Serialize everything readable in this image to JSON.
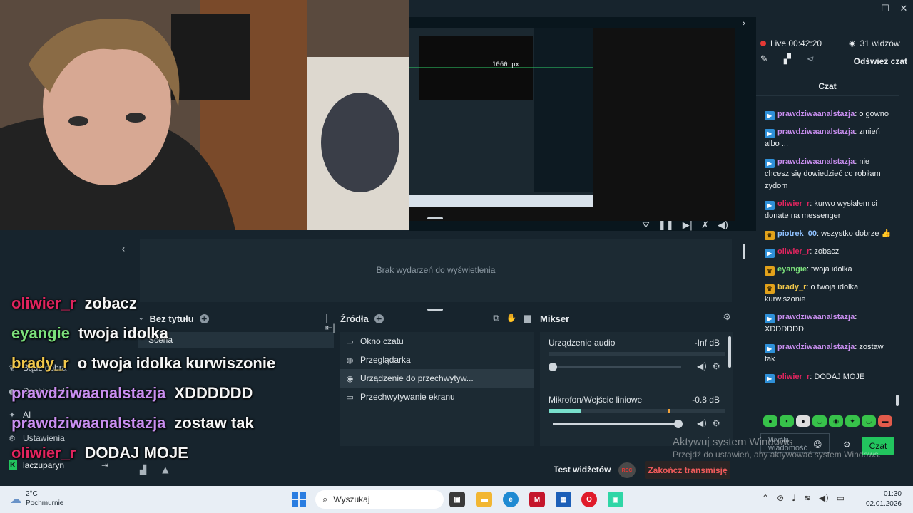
{
  "window": {
    "minimize": "—",
    "maximize": "☐",
    "close": "✕"
  },
  "preview": {
    "label_px": "1060 px",
    "collapse_icon": "chevron-right-icon",
    "tools": [
      "filter-icon",
      "pause-icon",
      "skip-icon",
      "mic-off-icon",
      "volume-icon"
    ]
  },
  "events": {
    "empty": "Brak wydarzeń do wyświetlenia"
  },
  "nav": {
    "items": [
      {
        "label": "Bądź dobra",
        "icon": "leaf-icon"
      },
      {
        "label": "Dashboard",
        "icon": "bell-icon"
      },
      {
        "label": "AI",
        "icon": "sparkle-icon"
      },
      {
        "label": "Ustawienia",
        "icon": "gear-icon"
      }
    ],
    "user": "laczuparyn",
    "user_badge": "K"
  },
  "scenes": {
    "title": "Bez tytułu",
    "items": [
      "Scena"
    ]
  },
  "sources": {
    "title": "Źródła",
    "items": [
      {
        "label": "Okno czatu",
        "icon": "chat-window-icon",
        "selected": false
      },
      {
        "label": "Przeglądarka",
        "icon": "globe-icon",
        "selected": false
      },
      {
        "label": "Urządzenie do przechwytyw...",
        "icon": "webcam-icon",
        "selected": true
      },
      {
        "label": "Przechwytywanie ekranu",
        "icon": "monitor-icon",
        "selected": false
      }
    ]
  },
  "mixer": {
    "title": "Mikser",
    "channels": [
      {
        "name": "Urządzenie audio",
        "db": "-Inf dB",
        "level": 0.0,
        "volume": 0.0
      },
      {
        "name": "Mikrofon/Wejście liniowe",
        "db": "-0.8 dB",
        "level": 0.18,
        "volume": 0.98
      }
    ]
  },
  "bottom": {
    "test_widgets": "Test widżetów",
    "rec": "REC",
    "end_stream": "Zakończ transmisję"
  },
  "overlay": [
    {
      "user": "oliwier_r",
      "color": "#e0245e",
      "msg": "zobacz"
    },
    {
      "user": "eyangie",
      "color": "#7be07b",
      "msg": "twoja idolka"
    },
    {
      "user": "brady_r",
      "color": "#f2c84b",
      "msg": "o twoja idolka kurwiszonie"
    },
    {
      "user": "prawdziwaanalstazja",
      "color": "#c98ef0",
      "msg": "XDDDDDD"
    },
    {
      "user": "prawdziwaanalstazja",
      "color": "#c98ef0",
      "msg": "zostaw tak"
    },
    {
      "user": "oliwier_r",
      "color": "#e0245e",
      "msg": "DODAJ MOJE"
    }
  ],
  "status": {
    "live": "Live 00:42:20",
    "viewers": "31 widzów",
    "refresh": "Odśwież czat"
  },
  "chat": {
    "title": "Czat",
    "messages": [
      {
        "badge": "twitch",
        "user": "prawdziwaanalstazja",
        "color": "#c98ef0",
        "text": "o gowno"
      },
      {
        "badge": "twitch",
        "user": "prawdziwaanalstazja",
        "color": "#c98ef0",
        "text": "zmień albo ..."
      },
      {
        "badge": "twitch",
        "user": "prawdziwaanalstazja",
        "color": "#c98ef0",
        "text": "nie chcesz się dowiedzieć co robiłam zydom"
      },
      {
        "badge": "twitch",
        "user": "oliwier_r",
        "color": "#e0245e",
        "text": "kurwo wysłałem ci donate na messenger"
      },
      {
        "badge": "crown",
        "user": "piotrek_00",
        "color": "#8fc1ff",
        "text": "wszystko dobrze 👍"
      },
      {
        "badge": "twitch",
        "user": "oliwier_r",
        "color": "#e0245e",
        "text": "zobacz"
      },
      {
        "badge": "crown",
        "user": "eyangie",
        "color": "#7be07b",
        "text": "twoja idolka"
      },
      {
        "badge": "crown",
        "user": "brady_r",
        "color": "#f2c84b",
        "text": "o twoja idolka kurwiszonie"
      },
      {
        "badge": "twitch",
        "user": "prawdziwaanalstazja",
        "color": "#c98ef0",
        "text": "XDDDDDD"
      },
      {
        "badge": "twitch",
        "user": "prawdziwaanalstazja",
        "color": "#c98ef0",
        "text": "zostaw tak"
      },
      {
        "badge": "twitch",
        "user": "oliwier_r",
        "color": "#e0245e",
        "text": "DODAJ MOJE"
      }
    ],
    "input_placeholder": "Wyślij wiadomość",
    "send": "Czat"
  },
  "watermark": {
    "line1": "Aktywuj system Windows",
    "line2": "Przejdź do ustawień, aby aktywować system Windows."
  },
  "taskbar": {
    "temp": "2°C",
    "weather": "Pochmurnie",
    "search": "Wyszukaj",
    "time": "01:30",
    "date": "02.01.2026"
  }
}
